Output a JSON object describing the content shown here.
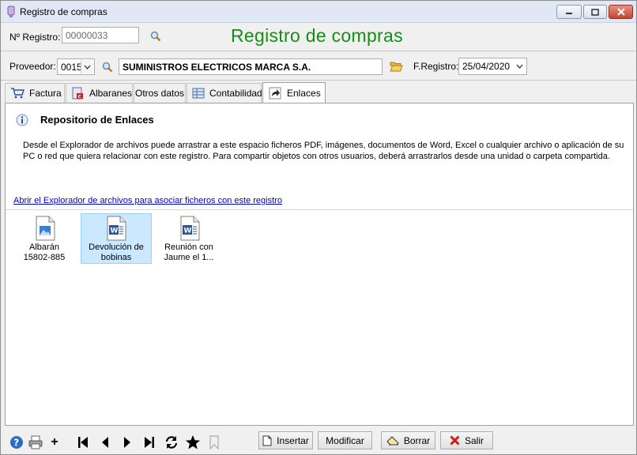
{
  "window": {
    "title": "Registro de compras"
  },
  "header": {
    "registro_label": "Nº Registro:",
    "registro_value": "00000033",
    "big_title": "Registro de compras",
    "proveedor_label": "Proveedor:",
    "proveedor_code": "0015",
    "proveedor_name": "SUMINISTROS ELECTRICOS MARCA S.A.",
    "fregistro_label": "F.Registro:",
    "fregistro_value": "25/04/2020"
  },
  "tabs": [
    {
      "label": "Factura",
      "icon": "cart-icon"
    },
    {
      "label": "Albaranes",
      "icon": "document-c-icon"
    },
    {
      "label": "Otros datos",
      "icon": ""
    },
    {
      "label": "Contabilidad",
      "icon": "ledger-icon"
    },
    {
      "label": "Enlaces",
      "icon": "shortcut-icon",
      "active": true
    }
  ],
  "enlaces": {
    "title": "Repositorio de Enlaces",
    "description": "Desde el Explorador de archivos puede arrastrar a este espacio ficheros PDF, imágenes,  documentos de Word, Excel o cualquier archivo o aplicación de su PC o red que quiera relacionar con este registro. Para compartir objetos con otros usuarios, deberá arrastrarlos desde una unidad o carpeta compartida.",
    "explorer_link": "Abrir el Explorador de archivos para asociar ficheros con este registro",
    "files": [
      {
        "name_line1": "Albarán",
        "name_line2": "15802-885",
        "type": "image-file-icon"
      },
      {
        "name_line1": "Devolución de",
        "name_line2": "bobinas",
        "type": "word-file-icon",
        "selected": true
      },
      {
        "name_line1": "Reunión con",
        "name_line2": "Jaume el 1...",
        "type": "word-file-icon"
      }
    ]
  },
  "toolbar": {
    "insertar": "Insertar",
    "modificar": "Modificar",
    "borrar": "Borrar",
    "salir": "Salir",
    "plus": "+"
  },
  "colors": {
    "title_green": "#138f13",
    "link_blue": "#0000cc",
    "selection": "#cce8ff"
  }
}
